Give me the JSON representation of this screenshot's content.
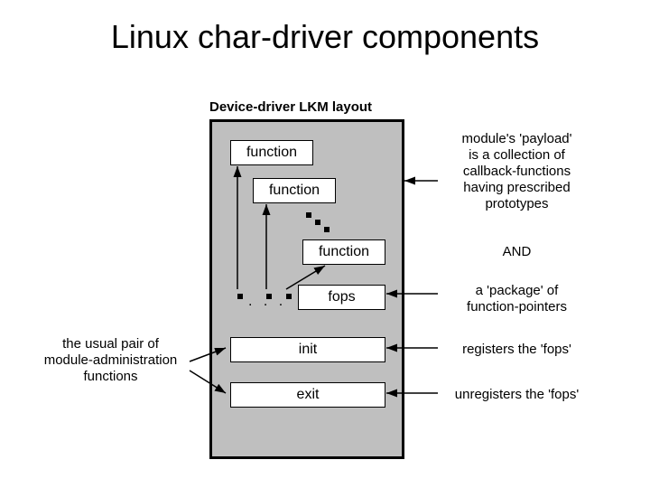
{
  "title": "Linux char-driver components",
  "subtitle": "Device-driver LKM layout",
  "boxes": {
    "func1": "function",
    "func2": "function",
    "func3": "function",
    "fops": "fops",
    "init": "init",
    "exit": "exit"
  },
  "ellipsis": ". . .",
  "notes": {
    "payload": "module's 'payload'\nis a collection of\ncallback-functions\nhaving prescribed\nprototypes",
    "and": "AND",
    "package": "a 'package' of\nfunction-pointers",
    "admin": "the usual pair of\nmodule-administration\nfunctions",
    "init": "registers the 'fops'",
    "exit": "unregisters the 'fops'"
  }
}
